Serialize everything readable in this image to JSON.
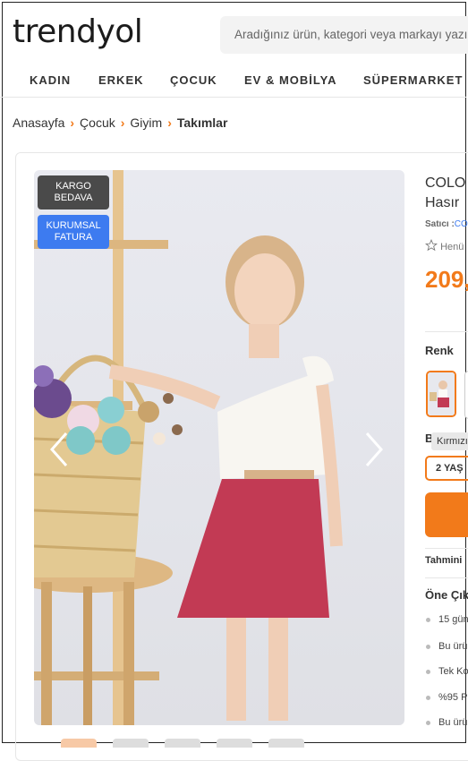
{
  "header": {
    "logo": "trendyol",
    "search_placeholder": "Aradığınız ürün, kategori veya markayı yazın"
  },
  "categories": [
    "KADIN",
    "ERKEK",
    "ÇOCUK",
    "EV & MOBİLYA",
    "SÜPERMARKET"
  ],
  "breadcrumb": [
    "Anasayfa",
    "Çocuk",
    "Giyim",
    "Takımlar"
  ],
  "gallery": {
    "badges": {
      "cargo": [
        "KARGO",
        "BEDAVA"
      ],
      "corporate": [
        "KURUMSAL",
        "FATURA"
      ]
    }
  },
  "product": {
    "brand": "COLO",
    "name": "Hasır",
    "seller_label": "Satıcı :",
    "seller_name": "CO",
    "rating_text": "Henü",
    "price": "209,",
    "color_label": "Renk",
    "size_label": "B",
    "size_tooltip": "Kırmızı",
    "selected_size": "2 YAŞ",
    "delivery_label": "Tahmini",
    "highlights_label": "Öne Çık",
    "highlights": [
      "15 gün",
      "Bu ürü",
      "Tek Ko",
      "%95 P",
      "Bu ürü"
    ]
  },
  "colors": {
    "accent": "#f27a1a",
    "badge_cargo": "#4a4a4a",
    "badge_corporate": "#3d7bf0"
  }
}
